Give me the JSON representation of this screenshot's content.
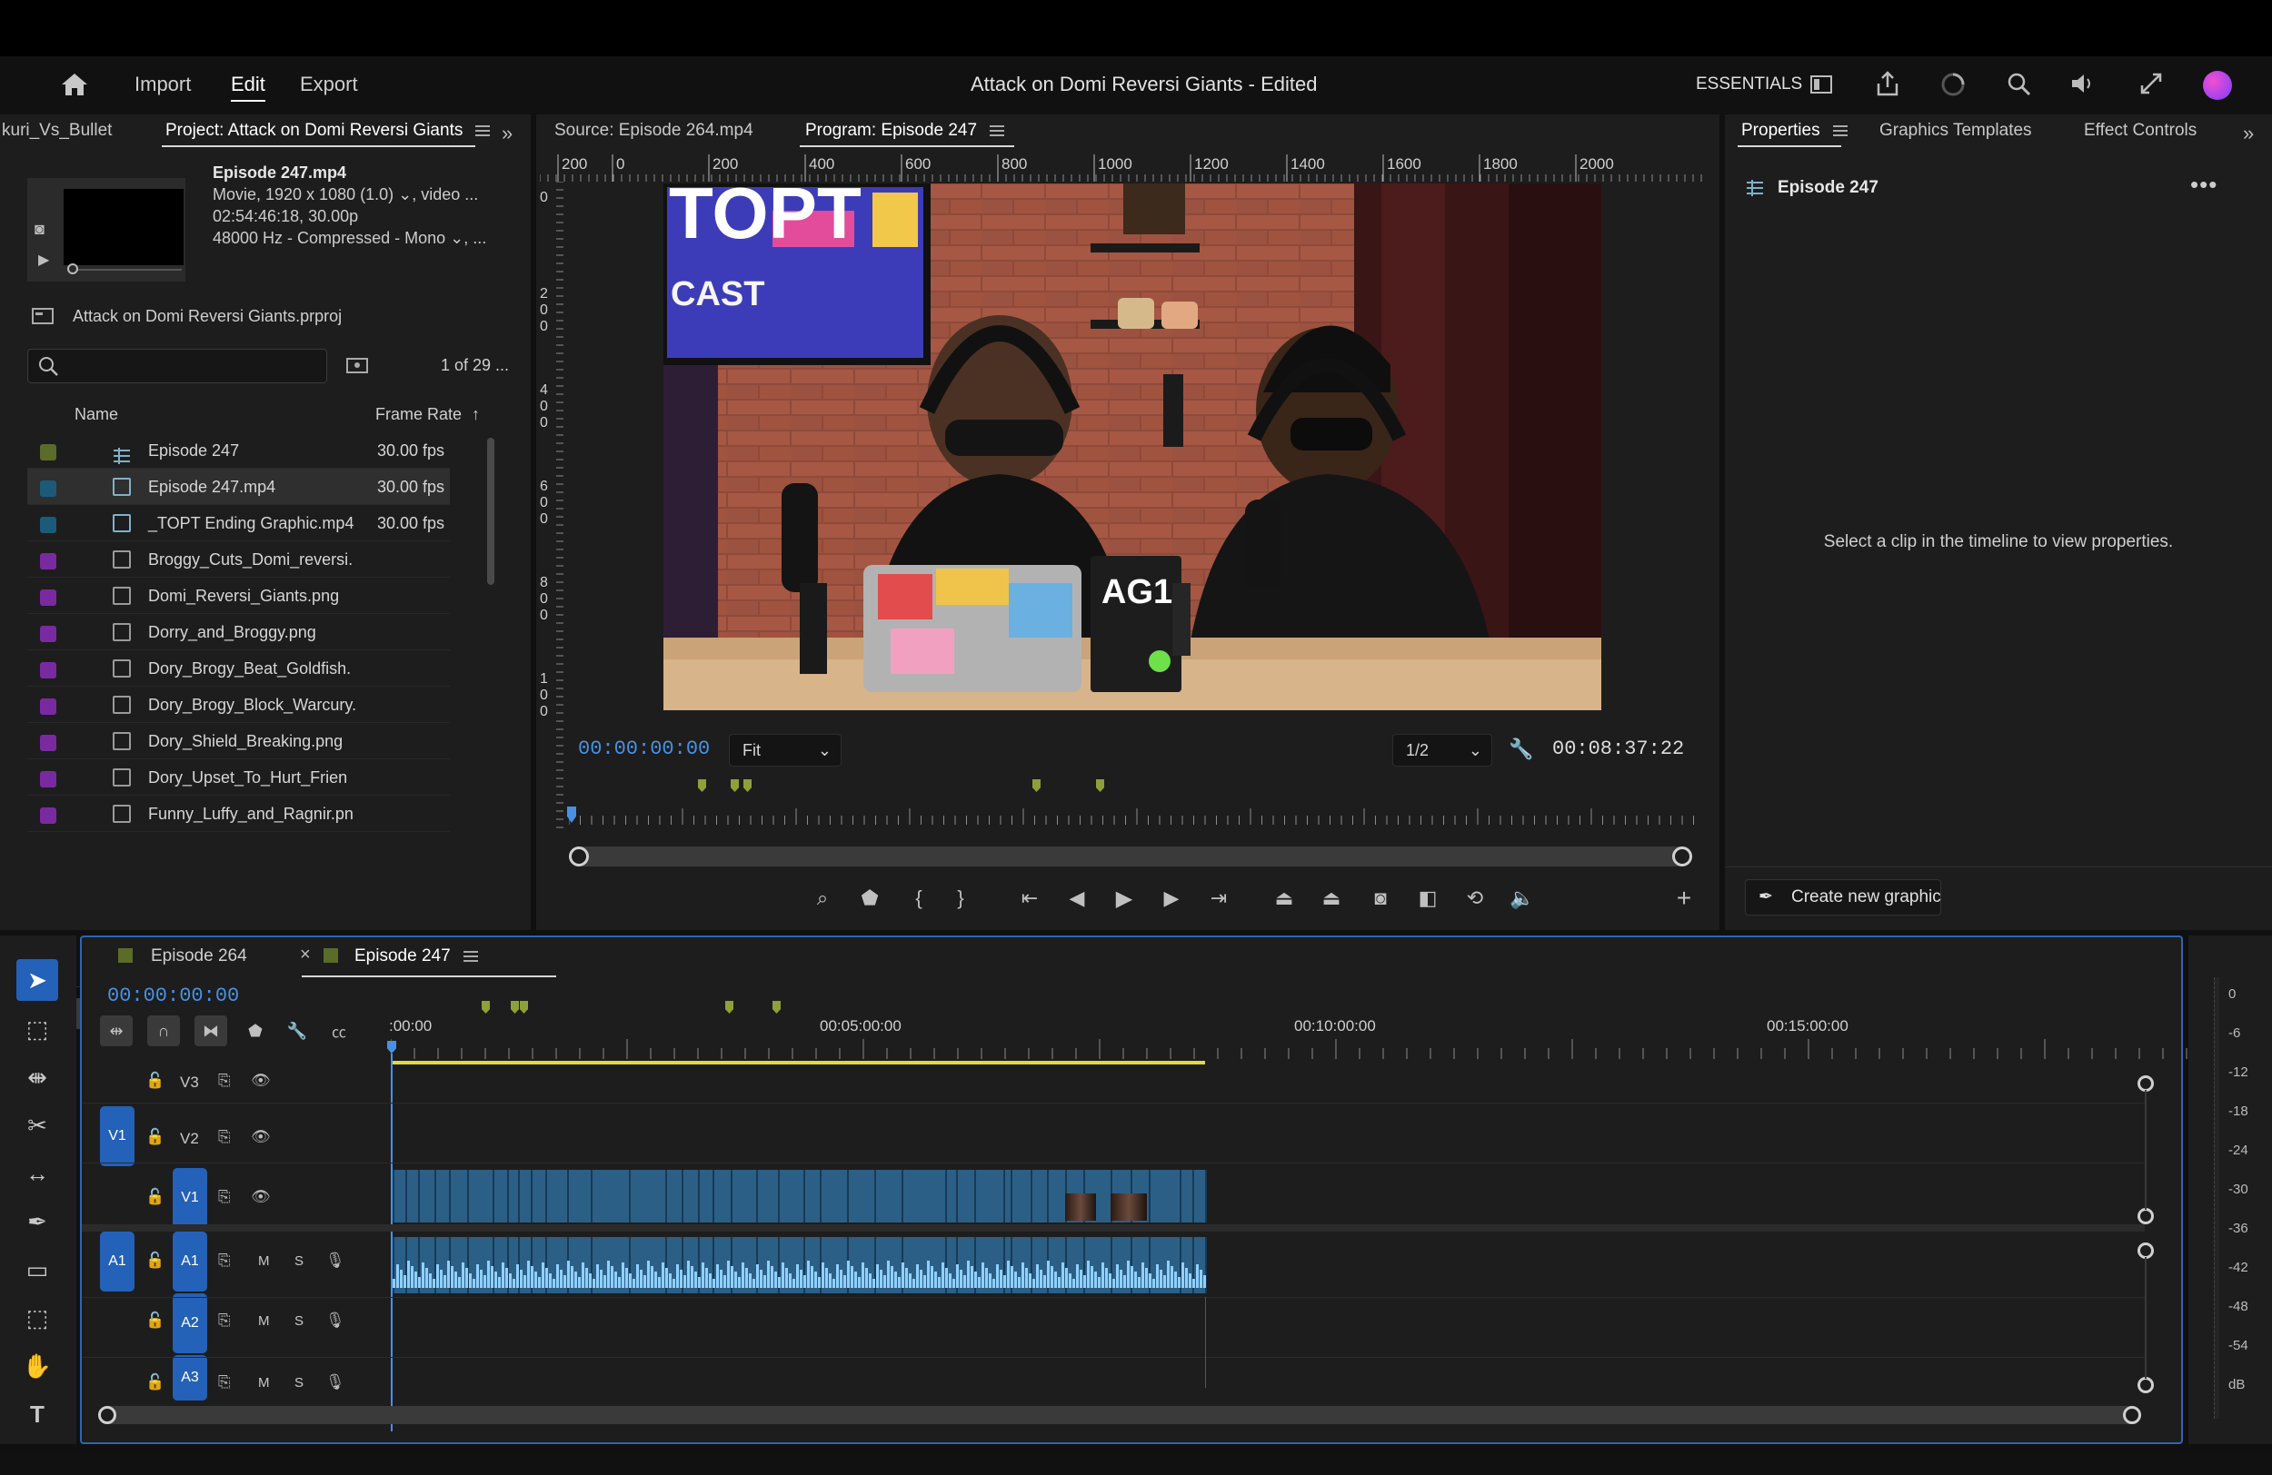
{
  "header": {
    "home_icon": "home-icon",
    "nav": [
      "Import",
      "Edit",
      "Export"
    ],
    "active_nav": "Edit",
    "title": "Attack on Domi Reversi Giants - Edited",
    "workspace": "ESSENTIALS",
    "icons": [
      "panel-layout-icon",
      "share-icon",
      "progress-circle-icon",
      "search-ai-icon",
      "volume-icon",
      "fullscreen-icon",
      "creative-cloud-icon"
    ]
  },
  "project_panel": {
    "tabs": [
      "kuri_Vs_Bullet",
      "Project: Attack on Domi Reversi Giants"
    ],
    "clip_info": {
      "name": "Episode 247.mp4",
      "line1": "Movie, 1920 x 1080 (1.0)",
      "line1_suffix": ", video ...",
      "line2": "02:54:46:18, 30.00p",
      "line3": "48000 Hz - Compressed - Mono",
      "line3_suffix": ", ..."
    },
    "project_file": "Attack on Domi Reversi Giants.prproj",
    "search_placeholder": "",
    "count": "1 of 29 ...",
    "columns": {
      "name": "Name",
      "frame_rate": "Frame Rate"
    },
    "items": [
      {
        "name": "Episode 247",
        "fps": "30.00 fps",
        "color": "#5b6b2a",
        "type": "sequence"
      },
      {
        "name": "Episode 247.mp4",
        "fps": "30.00 fps",
        "color": "#1c5a7a",
        "type": "video"
      },
      {
        "name": "_TOPT Ending Graphic.mp4",
        "fps": "30.00 fps",
        "color": "#1c5a7a",
        "type": "video"
      },
      {
        "name": "Broggy_Cuts_Domi_reversi.",
        "fps": "",
        "color": "#7a2aa0",
        "type": "image"
      },
      {
        "name": "Domi_Reversi_Giants.png",
        "fps": "",
        "color": "#7a2aa0",
        "type": "image"
      },
      {
        "name": "Dorry_and_Broggy.png",
        "fps": "",
        "color": "#7a2aa0",
        "type": "image"
      },
      {
        "name": "Dory_Brogy_Beat_Goldfish.",
        "fps": "",
        "color": "#7a2aa0",
        "type": "image"
      },
      {
        "name": "Dory_Brogy_Block_Warcury.",
        "fps": "",
        "color": "#7a2aa0",
        "type": "image"
      },
      {
        "name": "Dory_Shield_Breaking.png",
        "fps": "",
        "color": "#7a2aa0",
        "type": "image"
      },
      {
        "name": "Dory_Upset_To_Hurt_Frien",
        "fps": "",
        "color": "#7a2aa0",
        "type": "image"
      },
      {
        "name": "Funny_Luffy_and_Ragnir.pn",
        "fps": "",
        "color": "#7a2aa0",
        "type": "image"
      }
    ]
  },
  "monitor": {
    "tabs": [
      "Source: Episode 264.mp4",
      "Program: Episode 247"
    ],
    "ruler_labels": [
      "200",
      "0",
      "200",
      "400",
      "600",
      "800",
      "1000",
      "1200",
      "1400",
      "1600",
      "1800",
      "2000"
    ],
    "v_ruler_labels": [
      "0",
      "200",
      "400",
      "600",
      "800",
      "100"
    ],
    "timecode": "00:00:00:00",
    "fit": "Fit",
    "resolution": "1/2",
    "duration": "00:08:37:22",
    "video_text": {
      "topt": "TOPT",
      "cast": "CAST",
      "ag1": "AG1"
    }
  },
  "properties": {
    "tabs": [
      "Properties",
      "Graphics Templates",
      "Effect Controls"
    ],
    "sequence": "Episode 247",
    "message": "Select a clip in the timeline to view properties.",
    "create_button": "Create new graphic"
  },
  "timeline": {
    "tabs": [
      "Episode 264",
      "Episode 247"
    ],
    "timecode": "00:00:00:00",
    "ruler": [
      ":00:00",
      "00:05:00:00",
      "00:10:00:00",
      "00:15:00:00"
    ],
    "tracks": [
      {
        "label": "V3",
        "target": ""
      },
      {
        "label": "V2",
        "target": "V1"
      },
      {
        "label": "V1",
        "target": ""
      },
      {
        "label": "A1",
        "target": "A1",
        "m": "M",
        "s": "S"
      },
      {
        "label": "A2",
        "target": "",
        "m": "M",
        "s": "S"
      },
      {
        "label": "A3",
        "target": "",
        "m": "M",
        "s": "S"
      }
    ]
  },
  "audio_meter": {
    "labels": [
      "0",
      "-6",
      "-12",
      "-18",
      "-24",
      "-30",
      "-36",
      "-42",
      "-48",
      "-54",
      "dB"
    ]
  }
}
